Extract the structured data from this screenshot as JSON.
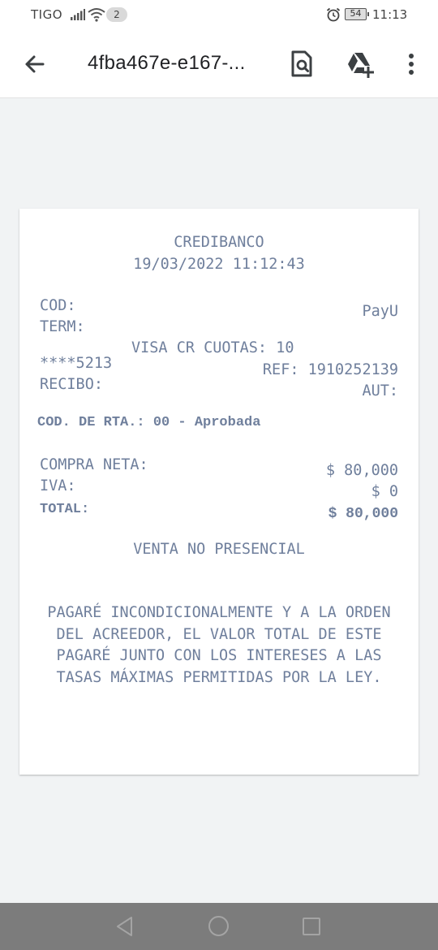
{
  "status_bar": {
    "carrier": "TIGO",
    "notification_count": "2",
    "battery": "54",
    "time": "11:13"
  },
  "app_bar": {
    "title": "4fba467e-e167-...",
    "icons": [
      "arrow-back-icon",
      "find-in-page-icon",
      "add-to-drive-icon",
      "more-vert-icon"
    ]
  },
  "receipt": {
    "bank": "CREDIBANCO",
    "datetime": "19/03/2022 11:12:43",
    "cod_label": "COD:",
    "merchant": "PayU",
    "term_label": "TERM:",
    "card_type": "VISA CR CUOTAS: 10",
    "card_number": "****5213",
    "ref": "REF: 1910252139",
    "recibo_label": "RECIBO:",
    "aut_label": "AUT:",
    "response": "COD. DE RTA.: 00 - Aprobada",
    "compra_label": "COMPRA NETA:",
    "compra_value": "$ 80,000",
    "iva_label": "IVA:",
    "iva_value": "$ 0",
    "total_label": "TOTAL:",
    "total_value": "$ 80,000",
    "sale_type": "VENTA NO PRESENCIAL",
    "disclaimer": "PAGARÉ INCONDICIONALMENTE Y A LA ORDEN DEL ACREEDOR, EL VALOR TOTAL DE ESTE PAGARÉ JUNTO CON LOS INTERESES A LAS TASAS MÁXIMAS PERMITIDAS POR LA LEY."
  },
  "nav_bar": {
    "icons": [
      "nav-back-icon",
      "nav-home-icon",
      "nav-recents-icon"
    ]
  }
}
